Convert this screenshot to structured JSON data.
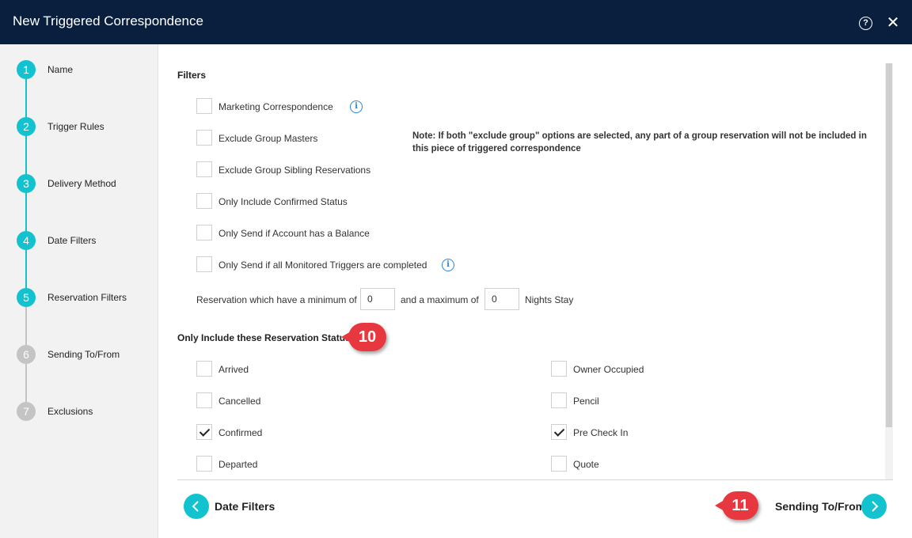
{
  "dialog": {
    "title": "New Triggered Correspondence"
  },
  "icons": {
    "help": "help-circle-icon",
    "close": "close-icon",
    "info": "info-circle-icon",
    "prev": "chevron-left-icon",
    "next": "chevron-right-icon",
    "check": "checkmark-icon"
  },
  "colors": {
    "header": "#0a1f3d",
    "accent": "#12c3cf",
    "inactive_step": "#c4c4c4",
    "callout": "#e8383f",
    "info": "#2e84d6"
  },
  "steps": [
    {
      "num": "1",
      "label": "Name",
      "state": "completed"
    },
    {
      "num": "2",
      "label": "Trigger Rules",
      "state": "completed"
    },
    {
      "num": "3",
      "label": "Delivery Method",
      "state": "completed"
    },
    {
      "num": "4",
      "label": "Date Filters",
      "state": "completed"
    },
    {
      "num": "5",
      "label": "Reservation Filters",
      "state": "current"
    },
    {
      "num": "6",
      "label": "Sending To/From",
      "state": "upcoming"
    },
    {
      "num": "7",
      "label": "Exclusions",
      "state": "upcoming"
    }
  ],
  "filters": {
    "title": "Filters",
    "items": [
      {
        "label": "Marketing Correspondence",
        "checked": false
      },
      {
        "label": "Exclude Group Masters",
        "checked": false
      },
      {
        "label": "Exclude Group Sibling Reservations",
        "checked": false
      },
      {
        "label": "Only Include Confirmed Status",
        "checked": false
      },
      {
        "label": "Only Send if Account has a Balance",
        "checked": false
      },
      {
        "label": "Only Send if all Monitored Triggers are completed",
        "checked": false
      }
    ],
    "note": "Note: If both \"exclude group\" options are selected, any part of a group reservation will not be included in this piece of triggered correspondence",
    "nights": {
      "prefix": "Reservation which have a minimum of",
      "min_value": "0",
      "middle": "and a maximum of",
      "max_value": "0",
      "suffix": "Nights Stay"
    }
  },
  "status_section": {
    "title": "Only Include these Reservation Status",
    "left": [
      {
        "label": "Arrived",
        "checked": false
      },
      {
        "label": "Cancelled",
        "checked": false
      },
      {
        "label": "Confirmed",
        "checked": true
      },
      {
        "label": "Departed",
        "checked": false
      }
    ],
    "right": [
      {
        "label": "Owner Occupied",
        "checked": false
      },
      {
        "label": "Pencil",
        "checked": false
      },
      {
        "label": "Pre Check In",
        "checked": true
      },
      {
        "label": "Quote",
        "checked": false
      }
    ]
  },
  "callouts": {
    "status": "10",
    "next": "11"
  },
  "nav": {
    "prev_label": "Date Filters",
    "next_label": "Sending To/From"
  }
}
